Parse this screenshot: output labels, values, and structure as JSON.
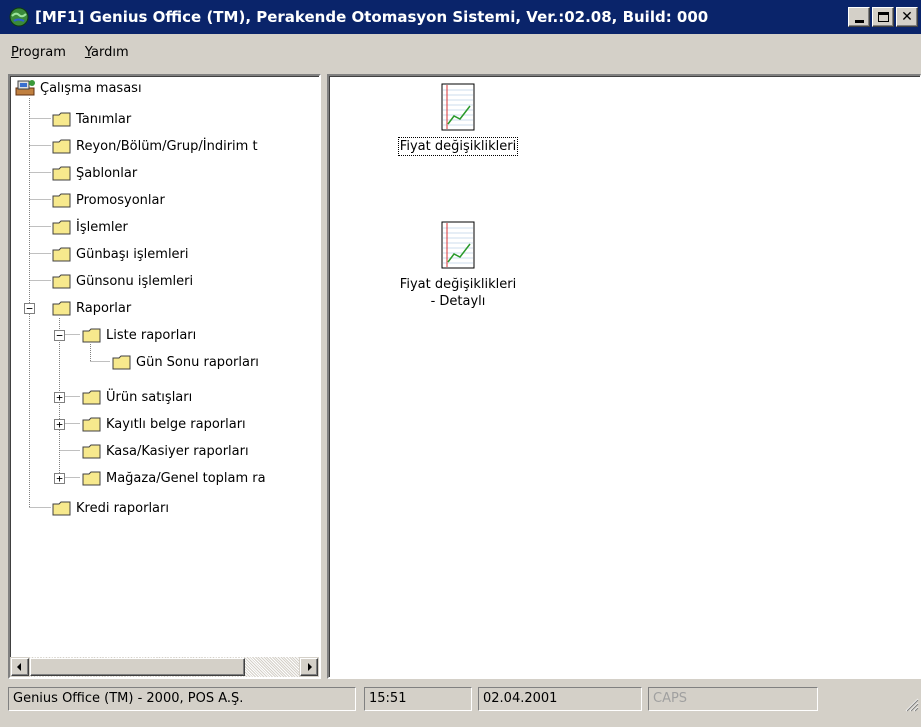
{
  "window": {
    "title": "[MF1] Genius Office (TM), Perakende Otomasyon Sistemi, Ver.:02.08, Build: 000",
    "controls": [
      "minimize",
      "maximize",
      "close"
    ]
  },
  "menu": {
    "items": [
      {
        "label": "Program",
        "underline": "P",
        "rest": "rogram"
      },
      {
        "label": "Yardım",
        "underline": "Y",
        "rest": "ardım"
      }
    ]
  },
  "tree": {
    "root": {
      "label": "Çalışma masası",
      "icon": "desk-icon"
    },
    "nodes": [
      {
        "label": "Tanımlar"
      },
      {
        "label": "Reyon/Bölüm/Grup/İndirim t"
      },
      {
        "label": "Şablonlar"
      },
      {
        "label": "Promosyonlar"
      },
      {
        "label": "İşlemler"
      },
      {
        "label": "Günbaşı işlemleri"
      },
      {
        "label": "Günsonu işlemleri"
      },
      {
        "label": "Raporlar",
        "expanded": true
      },
      {
        "label": "Liste raporları",
        "expanded": true
      },
      {
        "label": "Gün Sonu raporları"
      },
      {
        "label": "Ürün satışları",
        "expandable": true
      },
      {
        "label": "Kayıtlı belge raporları",
        "expandable": true
      },
      {
        "label": "Kasa/Kasiyer raporları"
      },
      {
        "label": "Mağaza/Genel toplam ra",
        "expandable": true
      },
      {
        "label": "Kredi raporları"
      }
    ]
  },
  "content": {
    "items": [
      {
        "label": "Fiyat değişiklikleri",
        "selected": true,
        "icon": "report-chart-icon"
      },
      {
        "label_line1": "Fiyat değişiklikleri",
        "label_line2": "- Detaylı",
        "icon": "report-chart-icon"
      }
    ]
  },
  "status": {
    "company": "Genius Office (TM) - 2000, POS A.Ş.",
    "time": "15:51",
    "date": "02.04.2001",
    "caps": "CAPS"
  },
  "colors": {
    "titlebar": "#0a246a",
    "face": "#d4d0c8",
    "folder": "#f7e98d"
  }
}
